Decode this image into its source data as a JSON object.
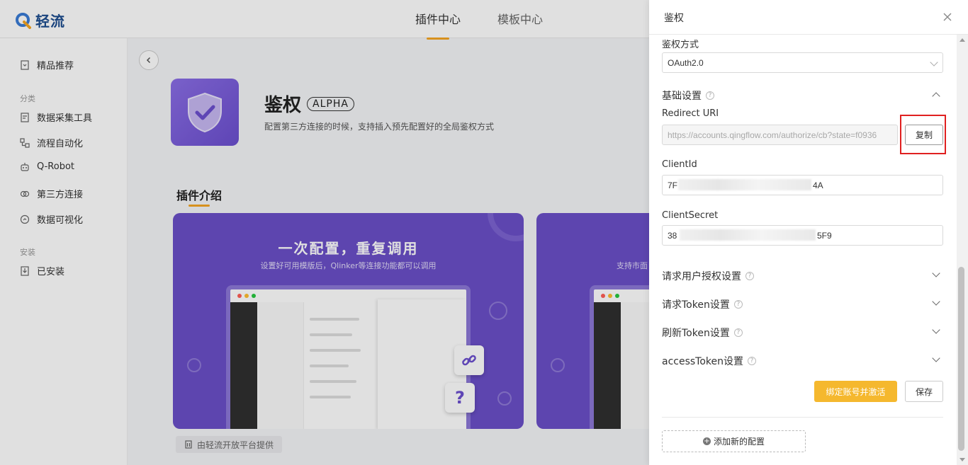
{
  "app": {
    "logo_text": "轻流"
  },
  "top_tabs": [
    {
      "label": "插件中心",
      "active": true
    },
    {
      "label": "模板中心",
      "active": false
    }
  ],
  "sidebar": {
    "featured": "精品推荐",
    "group_category": "分类",
    "items": [
      "数据采集工具",
      "流程自动化",
      "Q-Robot",
      "第三方连接",
      "数据可视化"
    ],
    "group_installed": "安装",
    "installed": "已安装"
  },
  "plugin": {
    "name": "鉴权",
    "badge": "ALPHA",
    "description": "配置第三方连接的时候，支持插入预先配置好的全局鉴权方式",
    "intro_title": "插件介绍",
    "banner1_heading": "一次配置，重复调用",
    "banner1_sub": "设置好可用模版后，Qlinker等连接功能都可以调用",
    "banner2_sub": "支持市面",
    "provider": "由轻流开放平台提供"
  },
  "drawer": {
    "title": "鉴权",
    "auth_method_label": "鉴权方式",
    "auth_method_value": "OAuth2.0",
    "basic_settings": "基础设置",
    "redirect_uri_label": "Redirect URI",
    "redirect_uri_value": "https://accounts.qingflow.com/authorize/cb?state=f0936",
    "copy_label": "复制",
    "client_id_label": "ClientId",
    "client_id_prefix": "7F",
    "client_id_suffix": "4A",
    "client_secret_label": "ClientSecret",
    "client_secret_prefix": "38",
    "client_secret_suffix": "5F9",
    "sections": [
      "请求用户授权设置",
      "请求Token设置",
      "刷新Token设置",
      "accessToken设置"
    ],
    "bind_activate": "绑定账号并激活",
    "save": "保存",
    "add_config": "添加新的配置"
  },
  "colors": {
    "accent": "#f5a623",
    "primary_button": "#f5b82e",
    "banner": "#6a4fc8",
    "highlight": "#e02020"
  }
}
